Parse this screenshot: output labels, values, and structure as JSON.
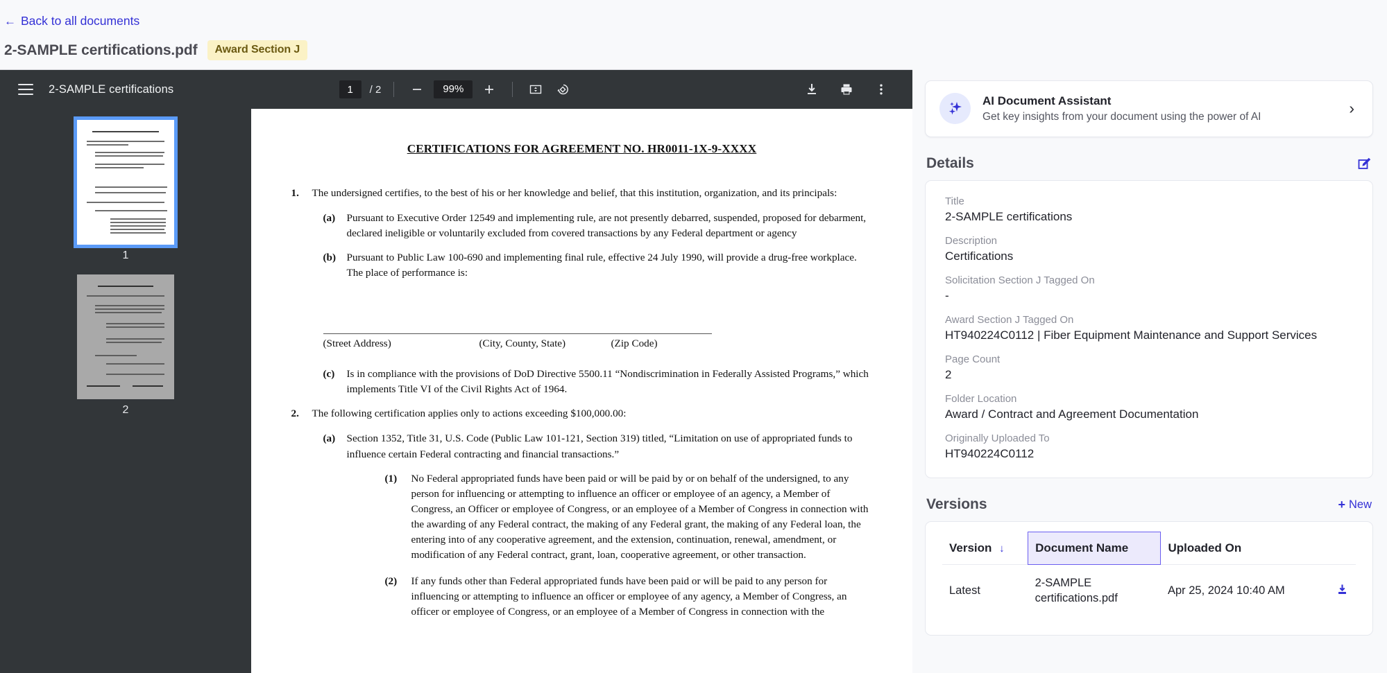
{
  "header": {
    "back_label": "Back to all documents",
    "back_icon": "arrow-left-icon",
    "document_title": "2-SAMPLE certifications.pdf",
    "badge": "Award Section J"
  },
  "pdf_viewer": {
    "menu_icon": "hamburger-menu-icon",
    "filename": "2-SAMPLE certifications",
    "current_page": "1",
    "page_total": "/ 2",
    "zoom_out_icon": "minus-icon",
    "zoom_level": "99%",
    "zoom_in_icon": "plus-icon",
    "fit_page_icon": "fit-to-page-icon",
    "rotate_icon": "rotate-icon",
    "download_icon": "download-icon",
    "print_icon": "print-icon",
    "more_icon": "more-vertical-icon",
    "thumbnails": [
      {
        "label": "1",
        "selected": true
      },
      {
        "label": "2",
        "selected": false
      }
    ],
    "document": {
      "heading": "CERTIFICATIONS FOR AGREEMENT NO. HR0011-1X-9-XXXX",
      "item1_label": "1.",
      "item1_text": "The undersigned certifies, to the best of his or her knowledge and belief, that this institution, organization, and its principals:",
      "item1a_label": "(a)",
      "item1a_text": "Pursuant to Executive Order 12549 and implementing rule, are not presently debarred, suspended, proposed for debarment, declared ineligible or voluntarily excluded from covered transactions by any Federal department or agency",
      "item1b_label": "(b)",
      "item1b_text": "Pursuant to Public Law 100-690 and implementing final rule, effective 24 July 1990, will provide a drug-free workplace. The place of performance is:",
      "addr_street": "(Street Address)",
      "addr_city": "(City, County, State)",
      "addr_zip": "(Zip Code)",
      "item1c_label": "(c)",
      "item1c_text": "Is in compliance with the provisions of DoD Directive 5500.11 “Nondiscrimination in Federally Assisted Programs,” which implements Title VI of the Civil Rights Act of 1964.",
      "item2_label": "2.",
      "item2_text": "The following certification applies only to actions exceeding $100,000.00:",
      "item2a_label": "(a)",
      "item2a_text": "Section 1352, Title 31, U.S. Code (Public Law 101-121, Section 319) titled, “Limitation on use of appropriated funds to influence certain Federal contracting and financial transactions.”",
      "item2a1_label": "(1)",
      "item2a1_text": "No Federal appropriated funds have been paid or will be paid by or on behalf of the undersigned, to any person for influencing or attempting to influence an officer or employee of an agency, a Member of Congress, an Officer or employee of Congress, or an employee of a Member of Congress in connection with the awarding of any Federal contract, the making of any Federal grant, the making of any Federal loan, the entering into of any cooperative agreement, and the extension, continuation, renewal, amendment, or modification of any Federal contract, grant, loan, cooperative agreement, or other transaction.",
      "item2a2_label": "(2)",
      "item2a2_text": "If any funds other than Federal appropriated funds have been paid or will be paid to any person for influencing or attempting to influence an officer or employee of any agency, a Member of Congress, an officer or employee of Congress, or an employee of a Member of Congress in connection with the"
    }
  },
  "ai_assistant": {
    "icon": "sparkle-icon",
    "title": "AI Document Assistant",
    "subtitle": "Get key insights from your document using the power of AI",
    "chevron": "chevron-right-icon"
  },
  "details": {
    "section_title": "Details",
    "edit_icon": "edit-square-icon",
    "fields": [
      {
        "label": "Title",
        "value": "2-SAMPLE certifications"
      },
      {
        "label": "Description",
        "value": "Certifications"
      },
      {
        "label": "Solicitation Section J Tagged On",
        "value": "-"
      },
      {
        "label": "Award Section J Tagged On",
        "value": "HT940224C0112 | Fiber Equipment Maintenance and Support Services"
      },
      {
        "label": "Page Count",
        "value": "2"
      },
      {
        "label": "Folder Location",
        "value": "Award / Contract and Agreement Documentation"
      },
      {
        "label": "Originally Uploaded To",
        "value": "HT940224C0112"
      }
    ]
  },
  "versions": {
    "section_title": "Versions",
    "new_label": "New",
    "new_icon": "plus-icon",
    "columns": [
      "Version",
      "Document Name",
      "Uploaded On"
    ],
    "sort_icon": "sort-descending-arrow-icon",
    "rows": [
      {
        "version": "Latest",
        "name": "2-SAMPLE certifications.pdf",
        "uploaded_on": "Apr 25, 2024 10:40 AM",
        "download_icon": "download-icon"
      }
    ]
  },
  "colors": {
    "accent": "#3431d6",
    "badge_bg": "#fbf2c6",
    "badge_text": "#6b5a12",
    "toolbar_bg": "#323639",
    "selected_header_bg": "#eceafc",
    "selected_header_border": "#6a5df0"
  }
}
